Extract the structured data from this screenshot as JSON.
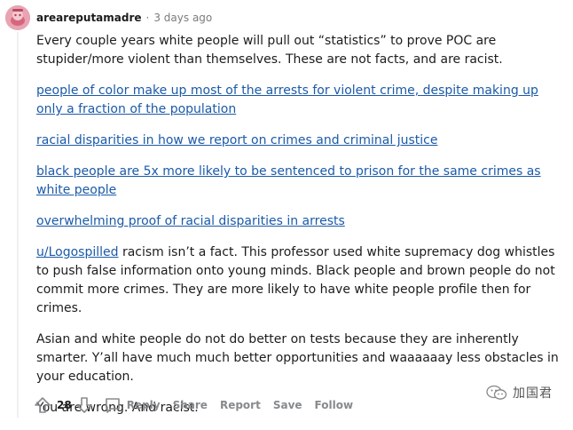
{
  "comment": {
    "username": "areareputamadre",
    "separator": "·",
    "timestamp": "3 days ago",
    "paragraphs": {
      "p1": "Every couple years white people will pull out “statistics” to prove POC are stupider/more violent than themselves. These are not facts, and are racist.",
      "link1": "people of color make up most of the arrests for violent crime, despite making up only a fraction of the population",
      "link2": "racial disparities in how we report on crimes and criminal justice",
      "link3": "black people are 5x more likely to be sentenced to prison for the same crimes as white people",
      "link4": "overwhelming proof of racial disparities in arrests",
      "mention": "u/Logospilled",
      "p_mention_rest": " racism isn’t a fact. This professor used white supremacy dog whistles to push false information onto young minds. Black people and brown people do not commit more crimes. They are more likely to have white people profile then for crimes.",
      "p_asian": "Asian and white people do not do better on tests because they are inherently smarter. Y’all have much much better opportunities and waaaaaay less obstacles in your education.",
      "p_final": "You are wrong. And racist."
    }
  },
  "actions": {
    "score": "28",
    "reply": "Reply",
    "share": "Share",
    "report": "Report",
    "save": "Save",
    "follow": "Follow"
  },
  "watermark": {
    "text": "加国君",
    "icon": "wechat-icon"
  },
  "colors": {
    "link": "#1b5aa8",
    "meta": "#7c7c7c",
    "action": "#878a8c",
    "avatar": "#e8a4b2"
  }
}
